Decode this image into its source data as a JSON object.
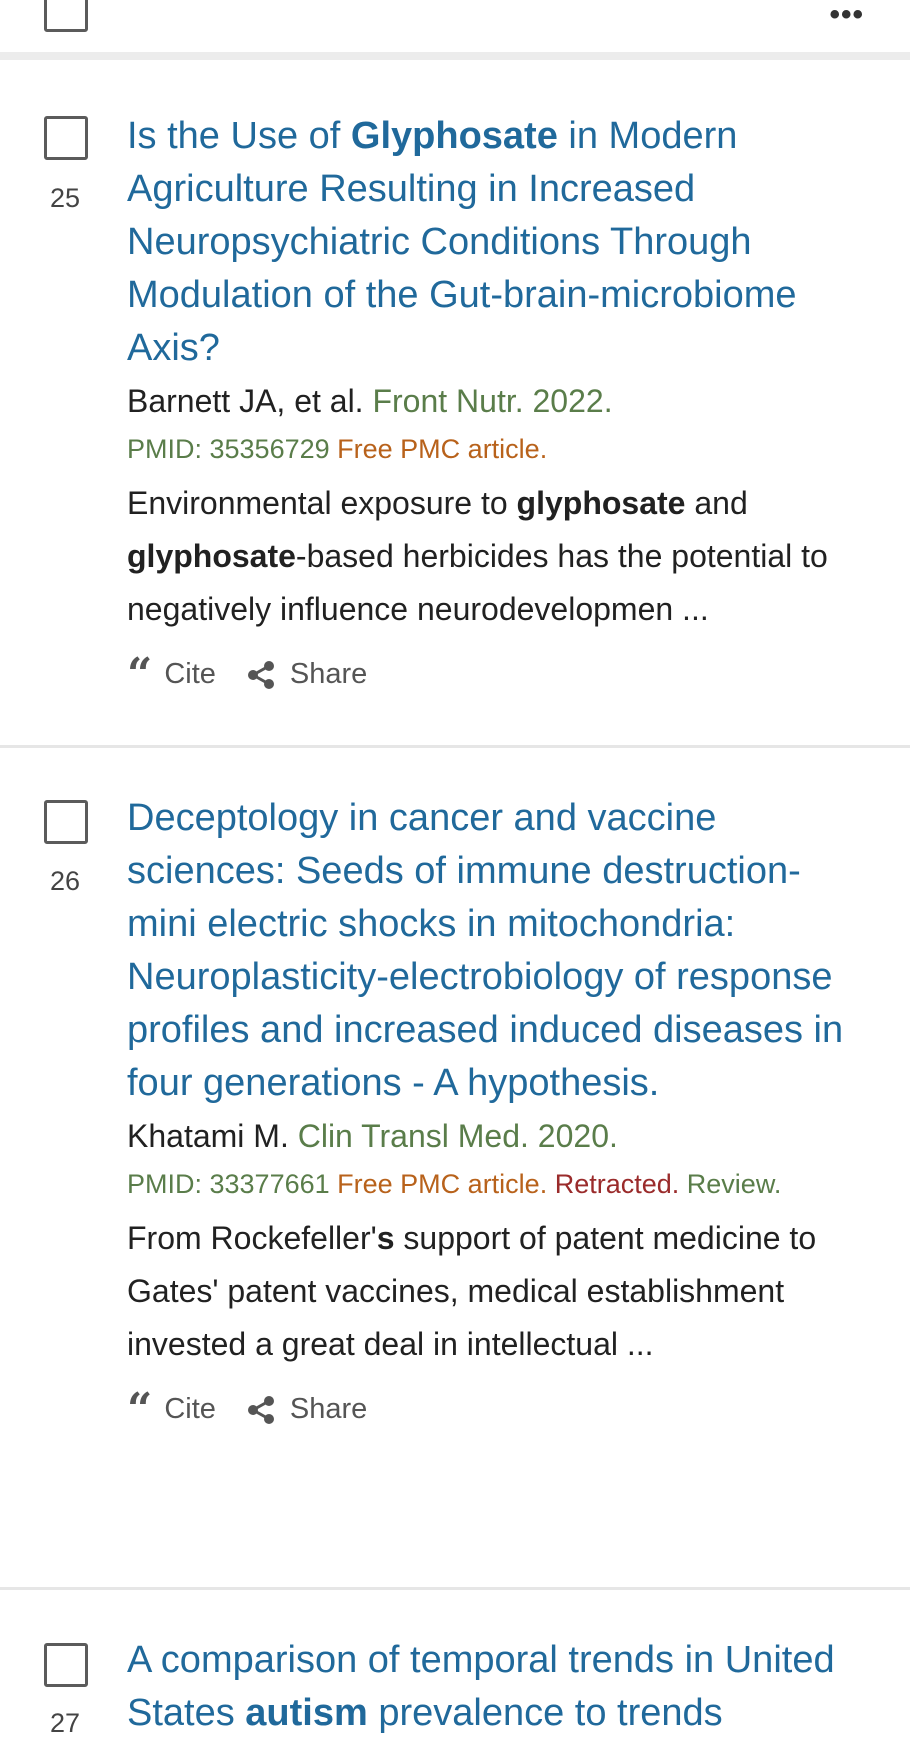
{
  "top": {
    "more_icon": "•••"
  },
  "results": [
    {
      "number": "25",
      "title_parts": [
        "Is the Use of ",
        "Glyphosate",
        " in Modern Agriculture Resulting in Increased Neuropsychiatric Conditions Through Modulation of the Gut-brain-microbiome Axis?"
      ],
      "authors": "Barnett JA, et al. ",
      "journal": "Front Nutr. 2022.",
      "pmid": "PMID: 35356729",
      "free": "Free PMC article.",
      "snippet_parts": [
        "Environmental exposure to ",
        "glyphosate",
        " and ",
        "glyphosate",
        "-based herbicides has the potential to negatively influence neurodevelopmen ..."
      ],
      "cite_label": "Cite",
      "share_label": "Share"
    },
    {
      "number": "26",
      "title_parts": [
        "Deceptology in cancer and vaccine sciences: Seeds of immune destruction-mini electric shocks in mitochondria: Neuroplasticity-electrobiology of response profiles and increased induced diseases in four generations - A hypothesis."
      ],
      "authors": "Khatami M. ",
      "journal": "Clin Transl Med. 2020.",
      "pmid": "PMID: 33377661",
      "free": "Free PMC article.",
      "retracted": "Retracted.",
      "review": "Review.",
      "snippet_parts": [
        "From Rockefeller'",
        "s",
        " support of patent medicine to Gates' patent vaccines, medical establishment invested a great deal in intellectual ..."
      ],
      "cite_label": "Cite",
      "share_label": "Share"
    },
    {
      "number": "27",
      "title_parts": [
        "A comparison of temporal trends in United States ",
        "autism",
        " prevalence to trends"
      ]
    }
  ]
}
